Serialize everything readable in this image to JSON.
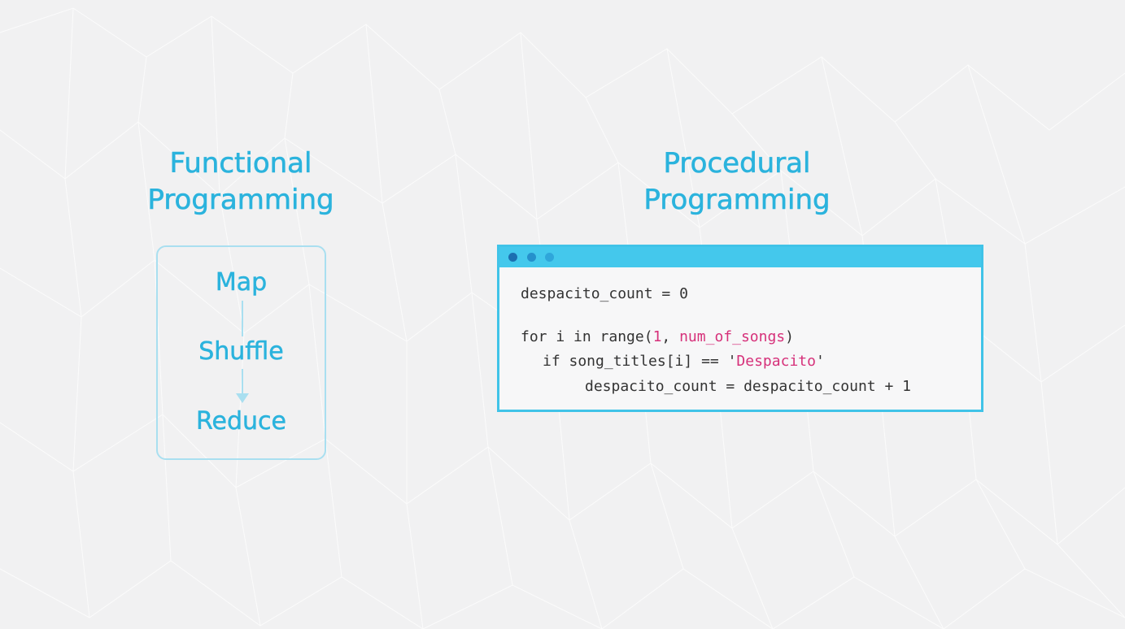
{
  "functional": {
    "heading": [
      "Functional",
      "Programming"
    ],
    "steps": {
      "map": "Map",
      "shuffle": "Shuffle",
      "reduce": "Reduce"
    }
  },
  "procedural": {
    "heading": [
      "Procedural",
      "Programming"
    ],
    "code": {
      "line1": "despacito_count = 0",
      "line2": {
        "prefix": "for i in range(",
        "num": "1",
        "sep": ", ",
        "var": "num_of_songs",
        "suffix": ")"
      },
      "line3": {
        "prefix": "if song_titles[i] == '",
        "str": "Despacito",
        "suffix": "'"
      },
      "line4": "despacito_count = despacito_count + 1"
    }
  },
  "colors": {
    "heading": "#2bb3dd",
    "box_border": "#a9dff0",
    "window_border": "#40c3e8",
    "title_bar": "#44c8ec",
    "code_text": "#333333",
    "code_highlight": "#d6317a"
  }
}
